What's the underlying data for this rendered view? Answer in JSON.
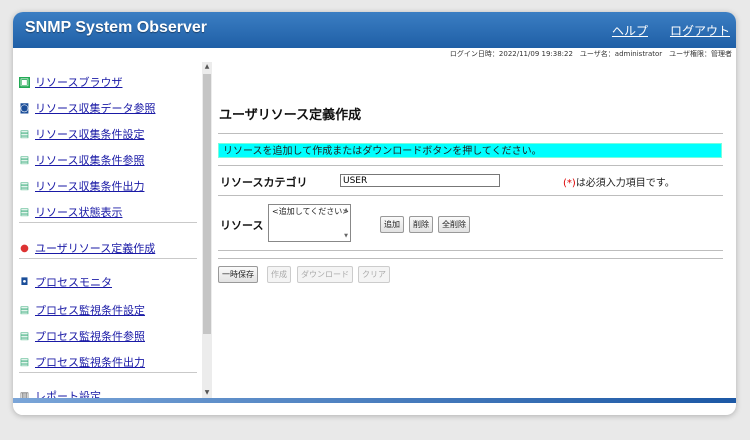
{
  "header": {
    "app_title": "SNMP System Observer",
    "help": "ヘルプ",
    "logout": "ログアウト"
  },
  "login_info": "ログイン日時：2022/11/09 19:38:22　ユーザ名：administrator　ユーザ権限：管理者",
  "sidebar": {
    "items": [
      {
        "label": "リソースブラウザ",
        "icon": "browser-icon"
      },
      {
        "label": "リソース収集データ参照",
        "icon": "data-view-icon"
      },
      {
        "label": "リソース収集条件設定",
        "icon": "settings-icon"
      },
      {
        "label": "リソース収集条件参照",
        "icon": "reference-icon"
      },
      {
        "label": "リソース収集条件出力",
        "icon": "export-icon"
      },
      {
        "label": "リソース状態表示",
        "icon": "status-icon"
      },
      {
        "label": "ユーザリソース定義作成",
        "icon": "user-resource-icon"
      },
      {
        "label": "プロセスモニタ",
        "icon": "monitor-icon"
      },
      {
        "label": "プロセス監視条件設定",
        "icon": "settings-icon"
      },
      {
        "label": "プロセス監視条件参照",
        "icon": "reference-icon"
      },
      {
        "label": "プロセス監視条件出力",
        "icon": "export-icon"
      },
      {
        "label": "レポート設定",
        "icon": "report-icon"
      }
    ]
  },
  "main": {
    "title": "ユーザリソース定義作成",
    "notice": "リソースを追加して作成またはダウンロードボタンを押してください。",
    "category_label": "リソースカテゴリ",
    "category_value": "USER",
    "required_note_star": "(*)",
    "required_note": "は必須入力項目です。",
    "resource_label": "リソース",
    "resource_placeholder": "<追加してください>",
    "buttons": {
      "add": "追加",
      "delete": "削除",
      "delete_all": "全削除"
    },
    "actions": {
      "save": "一時保存",
      "create": "作成",
      "download": "ダウンロード",
      "clear": "クリア"
    }
  }
}
